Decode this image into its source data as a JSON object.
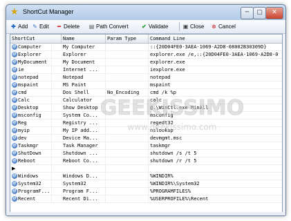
{
  "window": {
    "title": "ShortCut Manager",
    "minimize_label": "─",
    "maximize_label": "▢",
    "close_label": "✕"
  },
  "toolbar": {
    "add": "Add",
    "edit": "Edit",
    "delete": "Delete",
    "path_convert": "Path Convert",
    "validate": "Validate",
    "close": "Close",
    "cancel": "Cancel"
  },
  "table": {
    "columns": [
      "ShortCut",
      "Name",
      "Param Type",
      "Command Line"
    ],
    "rows": [
      [
        "Computer",
        "My Computer",
        "",
        "::{20D04FE0-3AEA-1069-A2D8-08002B30309D}"
      ],
      [
        "Explorer",
        "Explorer",
        "",
        "explorer.exe /e,::{20D04FE0-3AEA-1069-A2D8-0"
      ],
      [
        "MyDocument",
        "My Document",
        "",
        "explorer.exe"
      ],
      [
        "ie",
        "Internet ...",
        "",
        "iexplore.exe"
      ],
      [
        "notepad",
        "Notepad",
        "",
        "notepad"
      ],
      [
        "mspaint",
        "MS Paint",
        "",
        "mspaint"
      ],
      [
        "cmd",
        "Dos Shell",
        "No_Encoding",
        "cmd /k %p"
      ],
      [
        "Calc",
        "Calculator",
        "",
        "calc"
      ],
      [
        "Desktop",
        "Show Desktop",
        "",
        "@.\\WinCtl.exe MinAll"
      ],
      [
        "msconfig",
        "System Co...",
        "",
        "msconfig"
      ],
      [
        "Reg",
        "Registry ...",
        "",
        "regedt32"
      ],
      [
        "myip",
        "My IP add...",
        "",
        "nslookup"
      ],
      [
        "dev",
        "Device Ma...",
        "",
        "devmgmt.msc"
      ],
      [
        "Taskmgr",
        "Task Manager",
        "",
        "taskmgr"
      ],
      [
        "ShutDown",
        "Shutdown ...",
        "",
        "shutdown /s /t 5"
      ],
      [
        "Reboot",
        "Reboot Co...",
        "",
        "shutdown /r /t 5"
      ],
      [
        "",
        "",
        "",
        ""
      ],
      [
        "Windows",
        "Windows D...",
        "",
        "%WINDIR%"
      ],
      [
        "System32",
        "System32",
        "",
        "%WINDIR%\\System32"
      ],
      [
        "ProgramF...",
        "Program F...",
        "",
        "%PROGRAMFILES%"
      ],
      [
        "Recent",
        "Recent Di...",
        "",
        "%USERPROFILE%\\Recent"
      ]
    ]
  },
  "watermark": {
    "logo_text": "GEEKISSIMO",
    "url_text": "www.geekissimo.com"
  }
}
